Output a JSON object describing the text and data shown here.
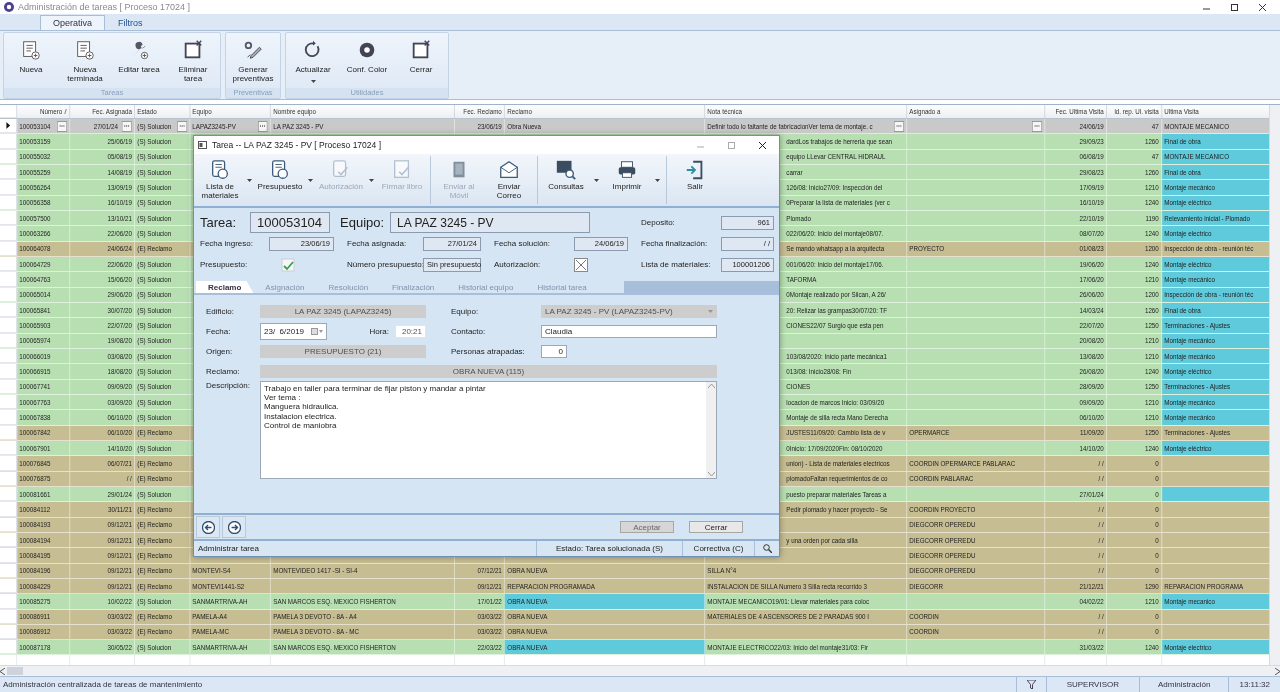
{
  "window": {
    "title": "Administración de tareas [ Proceso 17024 ]"
  },
  "ribbon": {
    "tabs": [
      {
        "label": "Operativa",
        "selected": true
      },
      {
        "label": "Filtros",
        "selected": false
      }
    ],
    "groups": [
      {
        "caption": "Tareas",
        "buttons": [
          {
            "label": "Nueva",
            "dropdown": false
          },
          {
            "label": "Nueva terminada",
            "dropdown": false
          },
          {
            "label": "Editar tarea",
            "dropdown": false
          },
          {
            "label": "Eliminar tarea",
            "dropdown": false
          }
        ]
      },
      {
        "caption": "Preventivas",
        "buttons": [
          {
            "label": "Generar preventivas",
            "dropdown": false
          }
        ]
      },
      {
        "caption": "Utilidades",
        "buttons": [
          {
            "label": "Actualizar",
            "dropdown": true
          },
          {
            "label": "Conf. Color",
            "dropdown": false
          },
          {
            "label": "Cerrar",
            "dropdown": false
          }
        ]
      }
    ]
  },
  "grid": {
    "columns": [
      "Número",
      "Fec. Asignada",
      "Estado",
      "Equipo",
      "Nombre equipo",
      "Fec. Reclamo",
      "Reclamo",
      "Nota técnica",
      "Asignado a",
      "Fec. Ultima Visita",
      "id. rep. Ul. visita",
      "Ultima Visita"
    ],
    "rows": [
      {
        "selected": true,
        "numero": "100053104",
        "fec_asignada": "27/01/24",
        "estado": "(S) Solucion",
        "equipo": "LAPAZ3245-PV",
        "nombre_equipo": "LA PAZ 3245 - PV",
        "fec_reclamo": "23/06/19",
        "reclamo": "Obra Nueva",
        "nota_tecnica": "Definir todo lo faltante de fabricacionVer tema de montaje. c",
        "fec_ultima_visita": "24/06/19",
        "id_rep": "47",
        "ultima_visita": "MONTAJE MECANICO"
      },
      {
        "selected": false,
        "color": "#b7dfb2",
        "numero": "100053159",
        "fec_asignada": "25/06/19",
        "estado": "(S) Solucion",
        "nota_tecnica": "dardLos trabajos de herreria que sean",
        "fec_ultima_visita": "29/09/23",
        "id_rep": "1260",
        "ultima_visita": {
          "text": "Final de obra",
          "color": "#5ecadb"
        }
      },
      {
        "selected": false,
        "color": "#b7dfb2",
        "numero": "100055032",
        "fec_asignada": "05/08/19",
        "estado": "(S) Solucion",
        "nota_tecnica": "equipo LLevar CENTRAL HIDRAUL",
        "fec_ultima_visita": "06/08/19",
        "id_rep": "47",
        "ultima_visita": {
          "text": "MONTAJE MECANICO",
          "color": "#5ecadb"
        }
      },
      {
        "selected": false,
        "color": "#b7dfb2",
        "numero": "100055259",
        "fec_asignada": "14/08/19",
        "estado": "(S) Solucion",
        "nota_tecnica": "carrar",
        "fec_ultima_visita": "29/08/23",
        "id_rep": "1260",
        "ultima_visita": {
          "text": "Final de obra",
          "color": "#5ecadb"
        }
      },
      {
        "selected": false,
        "color": "#b7dfb2",
        "numero": "100056264",
        "fec_asignada": "13/09/19",
        "estado": "(S) Solucion",
        "nota_tecnica": "126/08: Inicio27/09: Inspección del",
        "fec_ultima_visita": "17/09/19",
        "id_rep": "1210",
        "ultima_visita": {
          "text": "Montaje mecánico",
          "color": "#5ecadb"
        }
      },
      {
        "selected": false,
        "color": "#b7dfb2",
        "numero": "100056358",
        "fec_asignada": "16/10/19",
        "estado": "(S) Solucion",
        "nota_tecnica": "0Preparar la lista de materiales (ver c",
        "fec_ultima_visita": "16/10/19",
        "id_rep": "1240",
        "ultima_visita": {
          "text": "Montaje eléctrico",
          "color": "#5ecadb"
        }
      },
      {
        "selected": false,
        "color": "#b7dfb2",
        "numero": "100057500",
        "fec_asignada": "13/10/21",
        "estado": "(S) Solucion",
        "nota_tecnica": "Plomado",
        "fec_ultima_visita": "22/10/19",
        "id_rep": "1190",
        "ultima_visita": {
          "text": "Relevamiento inicial - Plomado",
          "color": "#5ecadb"
        }
      },
      {
        "selected": false,
        "color": "#b7dfb2",
        "numero": "100063266",
        "fec_asignada": "22/06/20",
        "estado": "(S) Solucion",
        "nota_tecnica": "022/06/20: Inicio del montaje08/07.",
        "fec_ultima_visita": "08/07/20",
        "id_rep": "1240",
        "ultima_visita": {
          "text": "Montaje electrico",
          "color": "#5ecadb"
        }
      },
      {
        "selected": false,
        "color": "#c6bd92",
        "numero": "100064078",
        "fec_asignada": "24/06/24",
        "estado": "(E) Reclamo",
        "nota_tecnica": "Se mando whatsapp a la arquitecta",
        "asignado_a": "PROYECTO",
        "fec_ultima_visita": "01/08/23",
        "id_rep": "1200",
        "ultima_visita": "Inspección de obra - reunión téc"
      },
      {
        "selected": false,
        "color": "#b7dfb2",
        "numero": "100064729",
        "fec_asignada": "22/06/20",
        "estado": "(S) Solucion",
        "nota_tecnica": "001/06/20: Inicio del montaje17/06.",
        "fec_ultima_visita": "19/06/20",
        "id_rep": "1240",
        "ultima_visita": {
          "text": "Montaje eléctrico",
          "color": "#5ecadb"
        }
      },
      {
        "selected": false,
        "color": "#b7dfb2",
        "numero": "100064763",
        "fec_asignada": "15/06/20",
        "estado": "(S) Solucion",
        "nota_tecnica": "TAFORMA",
        "fec_ultima_visita": "17/06/20",
        "id_rep": "1210",
        "ultima_visita": {
          "text": "Montaje mecánico",
          "color": "#5ecadb"
        }
      },
      {
        "selected": false,
        "color": "#b7dfb2",
        "numero": "100065014",
        "fec_asignada": "29/06/20",
        "estado": "(S) Solucion",
        "nota_tecnica": "0Montaje realizado por Silcan, A 26/",
        "fec_ultima_visita": "26/06/20",
        "id_rep": "1200",
        "ultima_visita": {
          "text": "Inspección de obra - reunión téc",
          "color": "#5ecadb"
        }
      },
      {
        "selected": false,
        "color": "#b7dfb2",
        "numero": "100065841",
        "fec_asignada": "30/07/20",
        "estado": "(S) Solucion",
        "nota_tecnica": "20: Relizar las grampas30/07/20: TF",
        "fec_ultima_visita": "14/03/24",
        "id_rep": "1260",
        "ultima_visita": {
          "text": "Final de obra",
          "color": "#5ecadb"
        }
      },
      {
        "selected": false,
        "color": "#b7dfb2",
        "numero": "100065903",
        "fec_asignada": "22/07/20",
        "estado": "(S) Solucion",
        "nota_tecnica": "CIONES22/07 Surgio que esta pen",
        "fec_ultima_visita": "22/07/20",
        "id_rep": "1250",
        "ultima_visita": {
          "text": "Terminaciones - Ajustes",
          "color": "#5ecadb"
        }
      },
      {
        "selected": false,
        "color": "#b7dfb2",
        "numero": "100065974",
        "fec_asignada": "19/08/20",
        "estado": "(S) Solucion",
        "fec_ultima_visita": "20/08/20",
        "id_rep": "1210",
        "ultima_visita": {
          "text": "Montaje mecánico",
          "color": "#5ecadb"
        }
      },
      {
        "selected": false,
        "color": "#b7dfb2",
        "numero": "100066019",
        "fec_asignada": "03/08/20",
        "estado": "(S) Solucion",
        "nota_tecnica": "103/08/2020: Inicio parte mecánica1",
        "fec_ultima_visita": "13/08/20",
        "id_rep": "1210",
        "ultima_visita": {
          "text": "Montaje mecánico",
          "color": "#5ecadb"
        }
      },
      {
        "selected": false,
        "color": "#b7dfb2",
        "numero": "100066915",
        "fec_asignada": "18/08/20",
        "estado": "(S) Solucion",
        "nota_tecnica": "013/08: Inicio28/08: Fin",
        "fec_ultima_visita": "26/08/20",
        "id_rep": "1240",
        "ultima_visita": {
          "text": "Montaje eléctrico",
          "color": "#5ecadb"
        }
      },
      {
        "selected": false,
        "color": "#b7dfb2",
        "numero": "100067741",
        "fec_asignada": "09/09/20",
        "estado": "(S) Solucion",
        "nota_tecnica": "CIONES",
        "fec_ultima_visita": "28/09/20",
        "id_rep": "1250",
        "ultima_visita": {
          "text": "Terminaciones - Ajustes",
          "color": "#5ecadb"
        }
      },
      {
        "selected": false,
        "color": "#b7dfb2",
        "numero": "100067763",
        "fec_asignada": "03/09/20",
        "estado": "(S) Solucion",
        "nota_tecnica": "locacion de marcos Inicio: 03/09/20",
        "fec_ultima_visita": "09/09/20",
        "id_rep": "1210",
        "ultima_visita": {
          "text": "Montaje mecánico",
          "color": "#5ecadb"
        }
      },
      {
        "selected": false,
        "color": "#b7dfb2",
        "numero": "100067838",
        "fec_asignada": "06/10/20",
        "estado": "(S) Solucion",
        "nota_tecnica": "Montaje de silla recta Mano Derecha",
        "fec_ultima_visita": "06/10/20",
        "id_rep": "1210",
        "ultima_visita": {
          "text": "Montaje mecánico",
          "color": "#5ecadb"
        }
      },
      {
        "selected": false,
        "color": "#c6bd92",
        "numero": "100067842",
        "fec_asignada": "06/10/20",
        "estado": "(E) Reclamo",
        "nota_tecnica": "JUSTES11/09/20: Cambio lista de v",
        "asignado_a": "OPERMARCE",
        "fec_ultima_visita": "11/09/20",
        "id_rep": "1250",
        "ultima_visita": "Terminaciones - Ajustes"
      },
      {
        "selected": false,
        "color": "#b7dfb2",
        "numero": "100067901",
        "fec_asignada": "14/10/20",
        "estado": "(S) Solucion",
        "nota_tecnica": "0Inicio: 17/09/2020Fin: 08/10/2020",
        "fec_ultima_visita": "14/10/20",
        "id_rep": "1240",
        "ultima_visita": {
          "text": "Montaje eléctrico",
          "color": "#5ecadb"
        }
      },
      {
        "selected": false,
        "color": "#c6bd92",
        "numero": "100076845",
        "fec_asignada": "06/07/21",
        "estado": "(E) Reclamo",
        "nota_tecnica": "union) - Lista de materiales electricos",
        "asignado_a": "COORDIN OPERMARCE PABLARAC",
        "fec_ultima_visita": "/ /",
        "id_rep": "0"
      },
      {
        "selected": false,
        "color": "#c6bd92",
        "numero": "100076875",
        "fec_asignada": "/ /",
        "estado": "(E) Reclamo",
        "nota_tecnica": "plomadoFaltan requerimientos de co",
        "asignado_a": "COORDIN PABLARAC",
        "fec_ultima_visita": "/ /",
        "id_rep": "0"
      },
      {
        "selected": false,
        "color": "#b7dfb2",
        "numero": "100081661",
        "fec_asignada": "29/01/24",
        "estado": "(S) Solucion",
        "nota_tecnica": "puesto preparar materiales Tareas a",
        "fec_ultima_visita": "27/01/24",
        "id_rep": "0",
        "ultima_visita": {
          "color": "#5ecadb"
        }
      },
      {
        "selected": false,
        "color": "#c6bd92",
        "numero": "100084112",
        "fec_asignada": "30/11/21",
        "estado": "(E) Reclamo",
        "nota_tecnica": "Pedir plomado y hacer proyecto - Se",
        "asignado_a": "COORDIN PROYECTO",
        "fec_ultima_visita": "/ /",
        "id_rep": "0"
      },
      {
        "selected": false,
        "color": "#c6bd92",
        "numero": "100084193",
        "fec_asignada": "09/12/21",
        "estado": "(E) Reclamo",
        "asignado_a": "DIEGCORR OPEREDU",
        "fec_ultima_visita": "/ /",
        "id_rep": "0"
      },
      {
        "selected": false,
        "color": "#c6bd92",
        "numero": "100084194",
        "fec_asignada": "09/12/21",
        "estado": "(E) Reclamo",
        "nota_tecnica": "y una orden por cada silla",
        "asignado_a": "DIEGCORR OPEREDU",
        "fec_ultima_visita": "/ /",
        "id_rep": "0"
      },
      {
        "selected": false,
        "color": "#c6bd92",
        "numero": "100084195",
        "fec_asignada": "09/12/21",
        "estado": "(E) Reclamo",
        "asignado_a": "DIEGCORR OPEREDU",
        "fec_ultima_visita": "/ /",
        "id_rep": "0"
      },
      {
        "selected": false,
        "color": "#c6bd92",
        "numero": "100084196",
        "fec_asignada": "09/12/21",
        "estado": "(E) Reclamo",
        "equipo": "MONTEVI-S4",
        "nombre_equipo": "MONTEVIDEO 1417 -SI - SI-4",
        "fec_reclamo": "07/12/21",
        "reclamo": "OBRA NUEVA",
        "nota_tecnica": "SILLA N°4",
        "asignado_a": "DIEGCORR OPEREDU",
        "fec_ultima_visita": "/ /",
        "id_rep": "0"
      },
      {
        "selected": false,
        "color": "#c6bd92",
        "numero": "100084229",
        "fec_asignada": "09/12/21",
        "estado": "(E) Reclamo",
        "equipo": "MONTEVI1441-S2",
        "fec_reclamo": "09/12/21",
        "reclamo": "REPARACION PROGRAMADA",
        "nota_tecnica": "INSTALACION DE SILLA Numero 3  Silla recta recorrido 3",
        "asignado_a": "DIEGCORR",
        "fec_ultima_visita": "21/12/21",
        "id_rep": "1290",
        "ultima_visita": "REPARACION PROGRAMA"
      },
      {
        "selected": false,
        "color": "#b7dfb2",
        "numero": "100085275",
        "fec_asignada": "10/02/22",
        "estado": "(S) Solucion",
        "equipo": "SANMARTRIVA-AH",
        "nombre_equipo": "SAN MARCOS ESQ. MEXICO FISHERTON",
        "fec_reclamo": "17/01/22",
        "reclamo": {
          "text": "OBRA NUEVA",
          "color": "#5ecadb"
        },
        "nota_tecnica": "MONTAJE MECANICO19/01: Llevar materiales para coloc",
        "fec_ultima_visita": "04/02/22",
        "id_rep": "1210",
        "ultima_visita": {
          "text": "Montaje mecanico",
          "color": "#5ecadb"
        }
      },
      {
        "selected": false,
        "color": "#c6bd92",
        "numero": "100086911",
        "fec_asignada": "03/03/22",
        "estado": "(E) Reclamo",
        "equipo": "PAMELA-A4",
        "nombre_equipo": "PAMELA 3 DEVOTO - 8A - A4",
        "fec_reclamo": "03/03/22",
        "reclamo": "OBRA NUEVA",
        "nota_tecnica": "MATERIALES DE 4 ASCENSORES DE 2 PARADAS 900 I",
        "asignado_a": "COORDIN",
        "fec_ultima_visita": "/ /",
        "id_rep": "0"
      },
      {
        "selected": false,
        "color": "#c6bd92",
        "numero": "100086912",
        "fec_asignada": "03/03/22",
        "estado": "(E) Reclamo",
        "equipo": "PAMELA-MC",
        "nombre_equipo": "PAMELA 3 DEVOTO - 8A - MC",
        "fec_reclamo": "03/03/22",
        "reclamo": "OBRA NUEVA",
        "asignado_a": "COORDIN",
        "fec_ultima_visita": "/ /",
        "id_rep": "0"
      },
      {
        "selected": false,
        "color": "#b7dfb2",
        "numero": "100087178",
        "fec_asignada": "30/05/22",
        "estado": "(S) Solucion",
        "equipo": "SANMARTRIVA-AH",
        "nombre_equipo": "SAN MARCOS ESQ. MEXICO FISHERTON",
        "fec_reclamo": "22/03/22",
        "reclamo": {
          "text": "OBRA NUEVA",
          "color": "#5ecadb"
        },
        "nota_tecnica": "MONTAJE ELECTRICO22/03: Inicio del montaje31/03: Fir",
        "fec_ultima_visita": "31/03/22",
        "id_rep": "1240",
        "ultima_visita": {
          "text": "Montaje electrico",
          "color": "#5ecadb"
        }
      }
    ]
  },
  "dialog": {
    "title": "Tarea -- LA PAZ 3245 - PV   [ Proceso 17024 ]",
    "toolbar": [
      {
        "label": "Lista de materiales",
        "disabled": false,
        "dropdown": true
      },
      {
        "label": "Presupuesto",
        "disabled": false,
        "dropdown": true
      },
      {
        "label": "Autorización",
        "disabled": true,
        "dropdown": true
      },
      {
        "label": "Firmar libro",
        "disabled": true,
        "dropdown": false
      },
      {
        "label": "Enviar al Móvil",
        "disabled": true,
        "dropdown": false
      },
      {
        "label": "Enviar Correo",
        "disabled": false,
        "dropdown": false
      },
      {
        "label": "Consultas",
        "disabled": false,
        "dropdown": true
      },
      {
        "label": "Imprimir",
        "disabled": false,
        "dropdown": true
      },
      {
        "label": "Salir",
        "disabled": false,
        "dropdown": false
      }
    ],
    "tarea": {
      "label": "Tarea:",
      "value": "100053104"
    },
    "equipo": {
      "label": "Equipo:",
      "value": "LA PAZ 3245 - PV"
    },
    "fields": [
      {
        "kind": "text",
        "label": "Deposito:",
        "value": "961"
      },
      {
        "kind": "text",
        "label": "Fecha ingreso:",
        "value": "23/06/19"
      },
      {
        "kind": "text",
        "label": "Fecha asignada:",
        "value": "27/01/24"
      },
      {
        "kind": "text",
        "label": "Fecha solución:",
        "value": "24/06/19"
      },
      {
        "kind": "text",
        "label": "Fecha finalización:",
        "value": "/ /"
      },
      {
        "kind": "check",
        "label": "Presupuesto:",
        "checked": true
      },
      {
        "kind": "text",
        "label": "Número presupuesto:",
        "value": "Sin presupuesto"
      },
      {
        "kind": "check",
        "label": "Autorización:",
        "checked": false
      },
      {
        "kind": "text",
        "label": "Lista de materiales:",
        "value": "100001206"
      }
    ],
    "tabs": [
      {
        "label": "Reclamo",
        "selected": true
      },
      {
        "label": "Asignación",
        "selected": false
      },
      {
        "label": "Resolución",
        "selected": false
      },
      {
        "label": "Finalización",
        "selected": false
      },
      {
        "label": "Historial equipo",
        "selected": false
      },
      {
        "label": "Historial tarea",
        "selected": false
      }
    ],
    "form": {
      "edificio": {
        "label": "Edificio:",
        "value": "LA PAZ 3245 (LAPAZ3245)"
      },
      "equipo": {
        "label": "Equipo:",
        "value": "LA PAZ 3245 - PV (LAPAZ3245-PV)"
      },
      "fecha": {
        "label": "Fecha:",
        "value": "23/  6/2019"
      },
      "hora": {
        "label": "Hora:",
        "value": "20:21"
      },
      "contacto": {
        "label": "Contacto:",
        "value": "Claudia"
      },
      "origen": {
        "label": "Origen:",
        "value": "PRESUPUESTO (21)"
      },
      "personas": {
        "label": "Personas atrapadas:",
        "value": "0"
      },
      "reclamo": {
        "label": "Reclamo:",
        "value": "OBRA NUEVA (115)"
      },
      "descripcion": {
        "label": "Descripción:",
        "value": "Trabajo en taller para terminar de fijar piston y mandar a pintar\nVer tema :\nManguera hidraulica.\nInstalacion electrica.\nControl de maniobra"
      }
    },
    "buttons": [
      {
        "label": "Aceptar",
        "disabled": true
      },
      {
        "label": "Cerrar",
        "disabled": false
      }
    ],
    "status": [
      "Administrar tarea",
      "Estado: Tarea solucionada (S)",
      "Correctiva (C)"
    ]
  },
  "status_bar": {
    "message": "Administración centralizada de tareas de mantenimiento",
    "user": "SUPERVISOR",
    "role": "Administración",
    "time": "13:11:32"
  }
}
